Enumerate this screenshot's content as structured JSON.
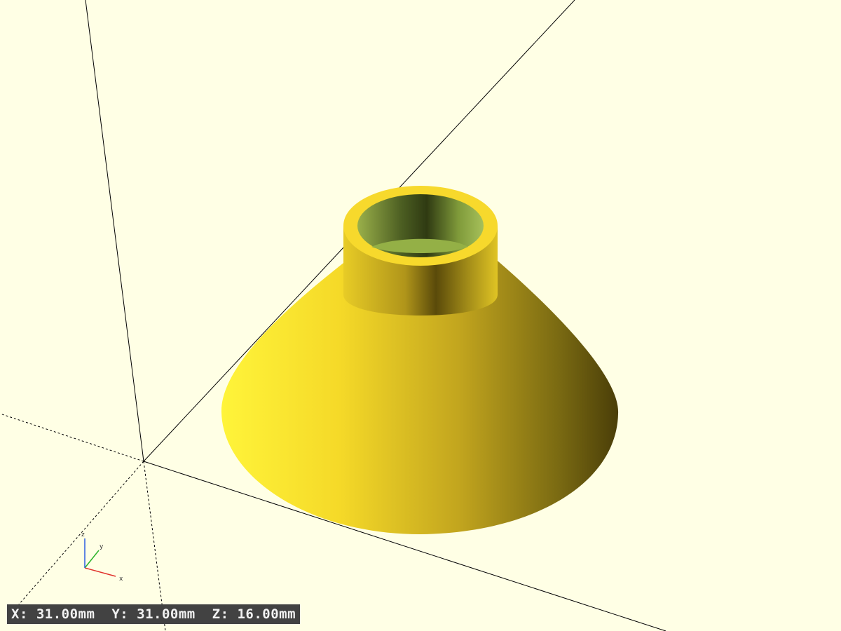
{
  "viewer": {
    "background": "#ffffe5"
  },
  "model": {
    "name": "funnel",
    "body_color": "#f9e234",
    "inner_color": "#7a9a40"
  },
  "axes_gizmo": {
    "x_label": "x",
    "y_label": "y",
    "z_label": "z",
    "x_color": "#e0312b",
    "y_color": "#2bb32b",
    "z_color": "#2b5ce0"
  },
  "dimensions": {
    "x_value": "31.00mm",
    "y_value": "31.00mm",
    "z_value": "16.00mm",
    "x_prefix": "X:",
    "y_prefix": "Y:",
    "z_prefix": "Z:"
  }
}
